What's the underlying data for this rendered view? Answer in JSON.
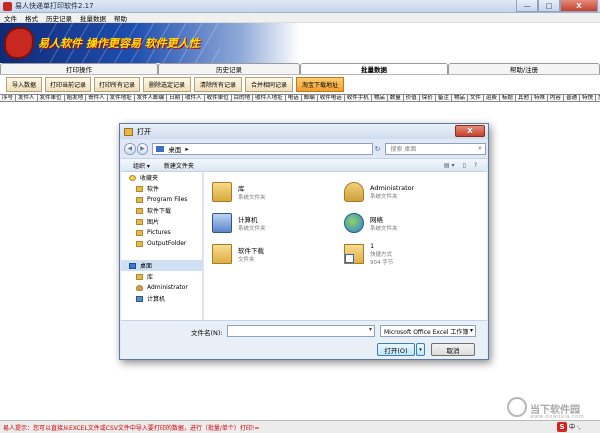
{
  "window": {
    "title": "易人快递单打印软件2.17",
    "minimize": "—",
    "maximize": "□",
    "close": "X"
  },
  "menu": [
    "文件",
    "格式",
    "历史记录",
    "批量数据",
    "帮助"
  ],
  "banner": {
    "text": "易人软件 操作更容易 软件更人性"
  },
  "main_tabs": [
    {
      "label": "打印操作",
      "active": false
    },
    {
      "label": "历史记录",
      "active": false
    },
    {
      "label": "批量数据",
      "active": true
    },
    {
      "label": "帮助/注册",
      "active": false
    }
  ],
  "toolbar": {
    "buttons": [
      "导入数据",
      "打印当前记录",
      "打印所有记录",
      "删除选定记录",
      "清除所有记录",
      "合并相同记录",
      "淘宝下载地址"
    ]
  },
  "columns": [
    "序号",
    "发件人",
    "发件单位",
    "始发地",
    "寄件人",
    "发件地址",
    "发件人邮编",
    "日期",
    "收件人",
    "收件单位",
    "目的地",
    "收件人地址",
    "电话",
    "邮编",
    "收件电话",
    "收件手机",
    "物品",
    "数量",
    "价值",
    "保价",
    "备注",
    "物品",
    "文件",
    "运费",
    "标题",
    "其他",
    "特殊",
    "内容",
    "普通",
    "特快",
    "加急",
    "其他",
    "重要",
    "其他"
  ],
  "dialog": {
    "title": "打开",
    "close": "X",
    "back": "◀",
    "forward": "▶",
    "address": "桌面",
    "address_arrow": "▸",
    "refresh": "↻",
    "search_placeholder": "搜索 桌面",
    "search_icon": "⌕",
    "organize": "组织 ▾",
    "new_folder": "新建文件夹",
    "view_icon": "▤ ▾",
    "pane_icon": "▯",
    "help_icon": "?",
    "nav_items": [
      {
        "label": "收藏夹",
        "icon": "star-icon",
        "top": true,
        "sel": false
      },
      {
        "label": "软件",
        "icon": "folder-icon",
        "top": false,
        "sel": false
      },
      {
        "label": "Program Files",
        "icon": "folder-icon",
        "top": false,
        "sel": false
      },
      {
        "label": "软件下载",
        "icon": "folder-icon",
        "top": false,
        "sel": false
      },
      {
        "label": "图片",
        "icon": "folder-icon",
        "top": false,
        "sel": false
      },
      {
        "label": "Pictures",
        "icon": "folder-icon",
        "top": false,
        "sel": false
      },
      {
        "label": "OutputFolder",
        "icon": "folder-icon",
        "top": false,
        "sel": false
      },
      {
        "label": "",
        "icon": "",
        "top": false,
        "sel": false
      },
      {
        "label": "桌面",
        "icon": "desktop-icon",
        "top": true,
        "sel": true
      },
      {
        "label": "库",
        "icon": "library-icon",
        "top": false,
        "sel": false
      },
      {
        "label": "Administrator",
        "icon": "user-icon",
        "top": false,
        "sel": false
      },
      {
        "label": "计算机",
        "icon": "computer-icon",
        "top": false,
        "sel": false
      }
    ],
    "files": [
      {
        "name": "库",
        "sub1": "系统文件夹",
        "sub2": "",
        "icon": "library-icon"
      },
      {
        "name": "Administrator",
        "sub1": "系统文件夹",
        "sub2": "",
        "icon": "user-folder-icon"
      },
      {
        "name": "计算机",
        "sub1": "系统文件夹",
        "sub2": "",
        "icon": "computer-icon"
      },
      {
        "name": "网络",
        "sub1": "系统文件夹",
        "sub2": "",
        "icon": "network-icon"
      },
      {
        "name": "软件下载",
        "sub1": "文件夹",
        "sub2": "",
        "icon": "folder-icon"
      },
      {
        "name": "1",
        "sub1": "快捷方式",
        "sub2": "904 字节",
        "icon": "shortcut-icon"
      }
    ],
    "filename_label": "文件名(N):",
    "filename_value": "",
    "filetype": "Microsoft Office Excel 工作簿",
    "dropdown_arrow": "▾",
    "open_label": "打开(O)",
    "open_split": "▾",
    "cancel_label": "取消"
  },
  "status": {
    "text": "易人提示：您可以直接从EXCEL文件或CSV文件中导入要打印的数据，进行（批量/单个）打印!="
  },
  "watermark": {
    "text": "当下软件园",
    "sub": "www.downxia.com"
  },
  "ime": {
    "logo": "S",
    "text": "中 ·,"
  }
}
